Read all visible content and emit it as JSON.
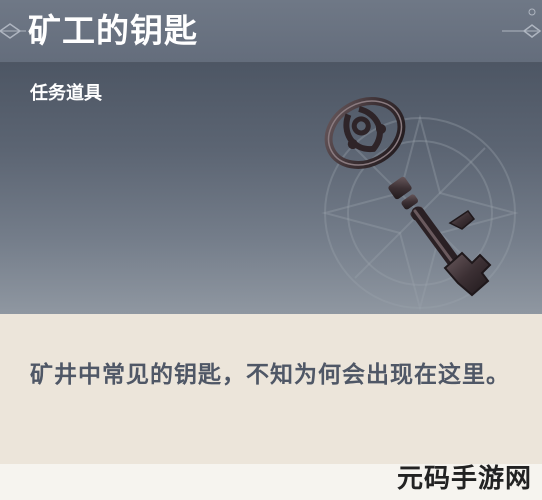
{
  "item": {
    "name": "矿工的钥匙",
    "category": "任务道具",
    "description": "矿井中常见的钥匙，不知为何会出现在这里。",
    "icon": "antique-key"
  },
  "watermark": "元码手游网",
  "colors": {
    "header_bg": "#6f7886",
    "art_bg_top": "#4d5664",
    "art_bg_bottom": "#8f97a1",
    "desc_bg": "#ece5da",
    "desc_text": "#4f5766"
  }
}
